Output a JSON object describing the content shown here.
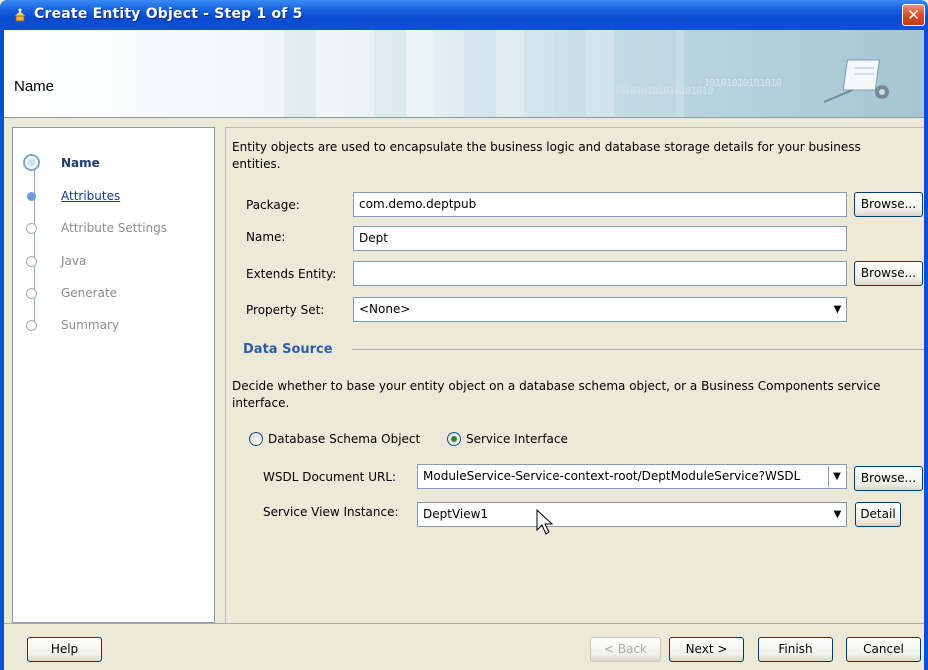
{
  "window": {
    "title": "Create Entity Object - Step 1 of 5",
    "close_glyph": "✕"
  },
  "header": {
    "heading": "Name",
    "decoration_text_1": "0101010101010101010",
    "decoration_text_2": "10101010101010"
  },
  "nav": {
    "items": [
      {
        "label": "Name",
        "state": "active"
      },
      {
        "label": "Attributes",
        "state": "link"
      },
      {
        "label": "Attribute Settings",
        "state": "disabled"
      },
      {
        "label": "Java",
        "state": "disabled"
      },
      {
        "label": "Generate",
        "state": "disabled"
      },
      {
        "label": "Summary",
        "state": "disabled"
      }
    ]
  },
  "main": {
    "intro": "Entity objects are used to encapsulate the business logic and database storage details for your business entities.",
    "package": {
      "label": "Package:",
      "value": "com.demo.deptpub",
      "browse": "Browse..."
    },
    "name": {
      "label": "Name:",
      "value": "Dept"
    },
    "extends": {
      "label": "Extends Entity:",
      "value": "",
      "browse": "Browse..."
    },
    "property_set": {
      "label": "Property Set:",
      "value": "<None>"
    },
    "data_source": {
      "title": "Data Source",
      "description": "Decide whether to base your entity object on a database schema object, or a Business Components service interface.",
      "option_db": "Database Schema Object",
      "option_service": "Service Interface",
      "selected": "Service Interface",
      "wsdl": {
        "label": "WSDL Document URL:",
        "value": "ModuleService-Service-context-root/DeptModuleService?WSDL",
        "browse": "Browse..."
      },
      "view_instance": {
        "label": "Service View Instance:",
        "value": "DeptView1",
        "detail": "Detail"
      }
    }
  },
  "footer": {
    "help": "Help",
    "back": "< Back",
    "next": "Next >",
    "finish": "Finish",
    "cancel": "Cancel"
  },
  "colors": {
    "title_bar": "#0a4ad0",
    "section_title": "#2a5fa8",
    "nav_active": "#1a3b70"
  }
}
